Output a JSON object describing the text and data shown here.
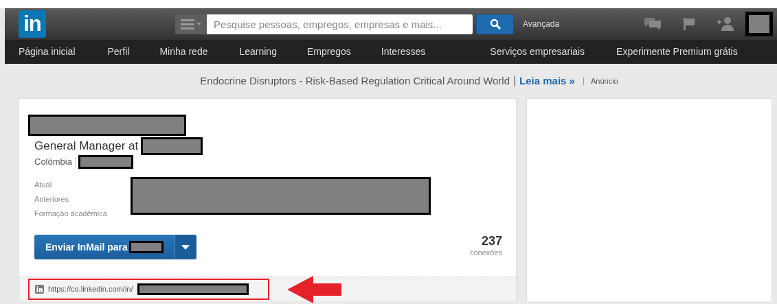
{
  "header": {
    "logo": "in",
    "search": {
      "placeholder": "Pesquise pessoas, empregos, empresas e mais..."
    },
    "advanced_link": "Avançada"
  },
  "nav": [
    "Página inicial",
    "Perfil",
    "Minha rede",
    "Learning",
    "Empregos",
    "Interesses",
    "Serviços empresariais",
    "Experimente Premium grátis"
  ],
  "ad": {
    "text": "Endocrine Disruptors - Risk-Based Regulation Critical Around World",
    "link": "Leia mais »",
    "label": "Anúncio"
  },
  "profile": {
    "headline": "General Manager at",
    "location": "Colômbia",
    "fields": [
      "Atual",
      "Anteriores",
      "Formação acadêmica"
    ],
    "inmail_button": "Enviar InMail para",
    "connections_count": "237",
    "connections_label": "conexões",
    "public_url": "https://co.linkedin.com/in/"
  }
}
